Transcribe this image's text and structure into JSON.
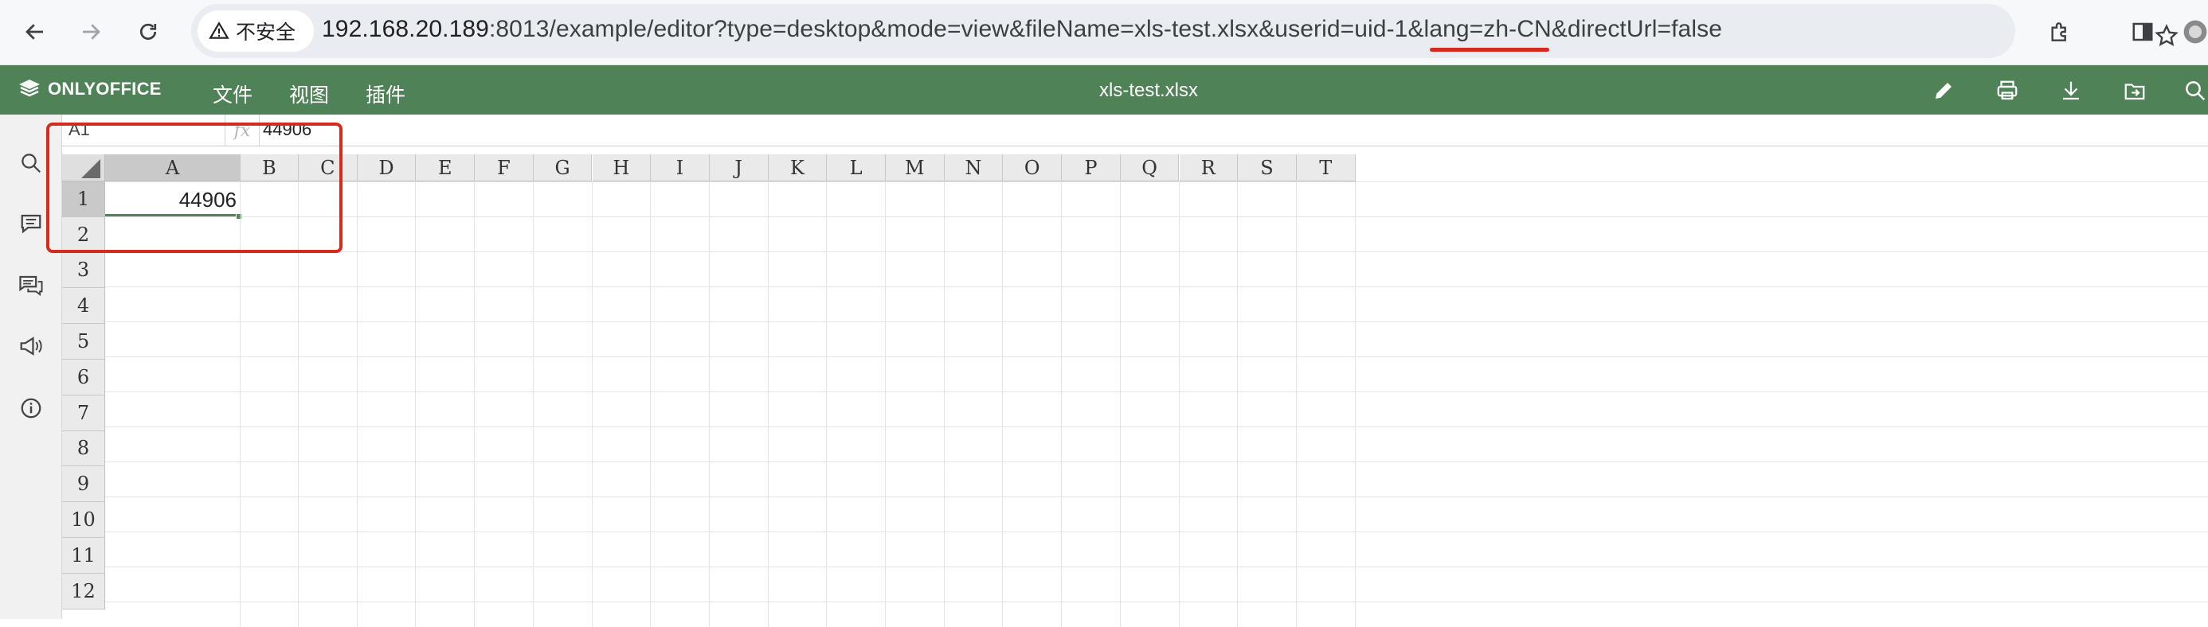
{
  "browser": {
    "security_label": "不安全",
    "url_host": "192.168.20.189",
    "url_rest": ":8013/example/editor?type=desktop&mode=view&fileName=xls-test.xlsx&userid=uid-1&lang=zh-CN&directUrl=false"
  },
  "app": {
    "logo_text": "ONLYOFFICE",
    "menu": [
      "文件",
      "视图",
      "插件"
    ],
    "doc_title": "xls-test.xlsx",
    "accent_color": "#4f8257"
  },
  "formula_bar": {
    "cell_ref": "A1",
    "fx_label": "fx",
    "value": "44906"
  },
  "sheet": {
    "columns": [
      "A",
      "B",
      "C",
      "D",
      "E",
      "F",
      "G",
      "H",
      "I",
      "J",
      "K",
      "L",
      "M",
      "N",
      "O",
      "P",
      "Q",
      "R",
      "S",
      "T"
    ],
    "rows": [
      "1",
      "2",
      "3",
      "4",
      "5",
      "6",
      "7",
      "8",
      "9",
      "10",
      "11",
      "12"
    ],
    "selected_cell": "A1",
    "a1_value": "44906"
  },
  "icons": {
    "sidebar": [
      "search-icon",
      "comment-icon",
      "chat-icon",
      "megaphone-icon",
      "info-icon"
    ],
    "toolbar": [
      "edit-pencil-icon",
      "print-icon",
      "download-icon",
      "open-location-icon",
      "search-icon"
    ]
  }
}
